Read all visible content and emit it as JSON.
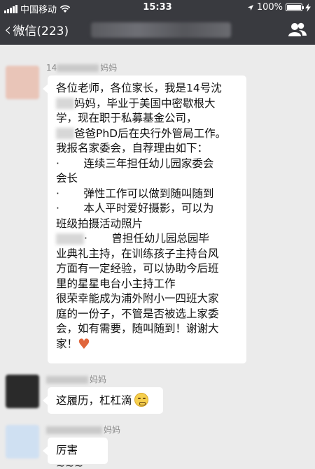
{
  "status_bar": {
    "carrier": "中国移动",
    "time": "15:33",
    "battery": "100%",
    "battery_level": 1.0
  },
  "nav": {
    "back_label": "微信(223)"
  },
  "messages": [
    {
      "sender_visible": "14",
      "sender_suffix": "妈妈",
      "lines": [
        "各位老师，各位家长，我是14号沈",
        "妈妈，毕业于美国中密歇根大",
        "学，现在职于私募基金公司，",
        "爸爸PhD后在央行外管局工作。",
        "我报名家委会，自荐理由如下：",
        "·       连续三年担任幼儿园家委会",
        "会长",
        "·       弹性工作可以做到随叫随到",
        "·       本人平时爱好摄影，可以为",
        "班级拍摄活动照片",
        "·       曾担任幼儿园总园毕",
        "业典礼主持，在训练孩子主持台风",
        "方面有一定经验，可以协助今后班",
        "里的星星电台小主持工作",
        "很荣幸能成为浦外附小一四班大家",
        "庭的一份子，不管是否被选上家委",
        "会，如有需要，随叫随到！谢谢大",
        "家！"
      ]
    },
    {
      "sender_suffix": "妈妈",
      "text": "这履历，杠杠滴"
    },
    {
      "sender_suffix": "妈妈",
      "text": "厉害~~~"
    }
  ],
  "colors": {
    "bar": "#393a3f",
    "background": "#ebebeb",
    "bubble": "#ffffff"
  }
}
